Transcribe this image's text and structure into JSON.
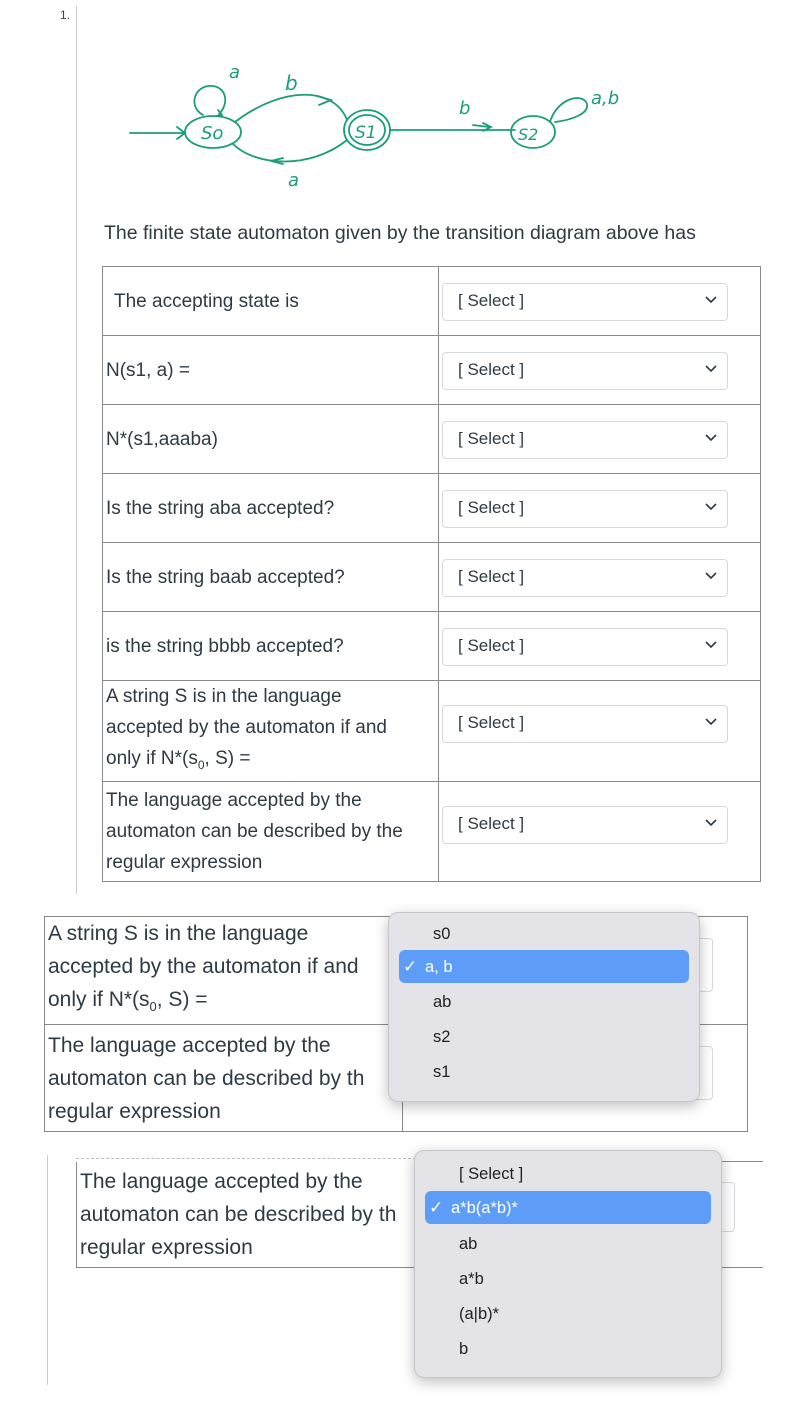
{
  "question_number": "1.",
  "diagram": {
    "states": [
      "So",
      "S1",
      "S2"
    ],
    "edge_labels": [
      "a",
      "b",
      "a",
      "b",
      "a,b"
    ]
  },
  "intro": "The finite state automaton given by the transition diagram above has",
  "rows": [
    {
      "label": "The accepting state is",
      "value": "[ Select ]"
    },
    {
      "label": "N(s1, a) =",
      "value": "[ Select ]"
    },
    {
      "label": "N*(s1,aaaba)",
      "value": "[ Select ]"
    },
    {
      "label": "Is the string aba accepted?",
      "value": "[ Select ]"
    },
    {
      "label": "Is the string baab accepted?",
      "value": "[ Select ]"
    },
    {
      "label": "is the string bbbb accepted?",
      "value": "[ Select ]"
    },
    {
      "label_lines": [
        "A string S is in the language",
        "accepted by the automaton if and",
        "only if N*(s",
        "0",
        ", S) ="
      ],
      "value": "[ Select ]"
    },
    {
      "label_lines": [
        "The language accepted by the",
        "automaton can be described by the",
        "regular expression"
      ],
      "value": "[ Select ]"
    }
  ],
  "popup1": {
    "options": [
      "s0",
      "a, b",
      "ab",
      "s2",
      "s1"
    ],
    "selected": "a, b",
    "check": "✓"
  },
  "snippet1": {
    "row1_lines": [
      "A string S is in the language",
      "accepted by the automaton if and",
      "only if N*(s",
      "0",
      ", S) ="
    ],
    "row2_lines": [
      "The language accepted by the",
      "automaton can be described by th",
      "regular expression"
    ]
  },
  "popup2": {
    "options": [
      "[ Select ]",
      "a*b(a*b)*",
      "ab",
      "a*b",
      "(a|b)*",
      "b"
    ],
    "selected": "a*b(a*b)*",
    "check": "✓"
  },
  "snippet2": {
    "row_lines": [
      "The language accepted by the",
      "automaton can be described by th",
      "regular expression"
    ]
  },
  "colors": {
    "highlight": "#5d9df7",
    "diagram_ink": "#1a9e7a"
  }
}
